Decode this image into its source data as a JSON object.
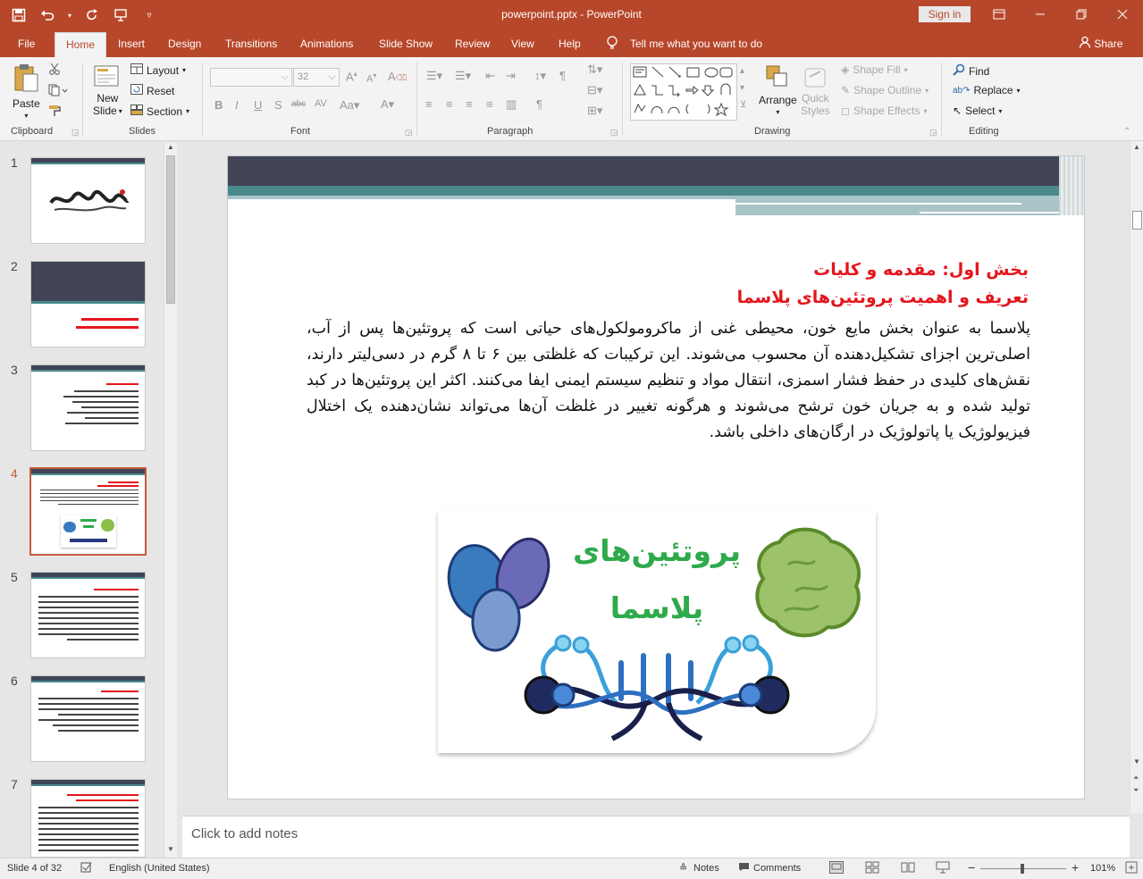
{
  "titlebar": {
    "title": "powerpoint.pptx  -  PowerPoint",
    "signin": "Sign in"
  },
  "tabs": [
    "File",
    "Home",
    "Insert",
    "Design",
    "Transitions",
    "Animations",
    "Slide Show",
    "Review",
    "View",
    "Help"
  ],
  "tellme": "Tell me what you want to do",
  "share": "Share",
  "ribbon": {
    "clipboard": {
      "paste": "Paste",
      "label": "Clipboard"
    },
    "slides": {
      "new_slide_1": "New",
      "new_slide_2": "Slide",
      "layout": "Layout",
      "reset": "Reset",
      "section": "Section",
      "label": "Slides"
    },
    "font": {
      "size": "32",
      "label": "Font"
    },
    "paragraph": {
      "label": "Paragraph"
    },
    "drawing": {
      "arrange": "Arrange",
      "quick_styles_1": "Quick",
      "quick_styles_2": "Styles",
      "shape_fill": "Shape Fill",
      "shape_outline": "Shape Outline",
      "shape_effects": "Shape Effects",
      "label": "Drawing"
    },
    "editing": {
      "find": "Find",
      "replace": "Replace",
      "select": "Select",
      "label": "Editing"
    }
  },
  "thumbnails": [
    {
      "num": "1"
    },
    {
      "num": "2"
    },
    {
      "num": "3"
    },
    {
      "num": "4"
    },
    {
      "num": "5"
    },
    {
      "num": "6"
    },
    {
      "num": "7"
    }
  ],
  "slide": {
    "heading1": "بخش اول: مقدمه و کلیات",
    "heading2": "تعریف و اهمیت پروتئین‌های پلاسما",
    "body": "پلاسما به عنوان بخش مایع خون، محیطی غنی از ماکرومولکول‌های حیاتی است که پروتئین‌ها پس از آب، اصلی‌ترین اجزای تشکیل‌دهنده آن محسوب می‌شوند. این ترکیبات که غلظتی بین ۶ تا ۸ گرم در دسی‌لیتر دارند، نقش‌های کلیدی در حفظ فشار اسمزی، انتقال مواد و تنظیم سیستم ایمنی ایفا می‌کنند. اکثر این پروتئین‌ها در کبد تولید شده و به جریان خون ترشح می‌شوند و هرگونه تغییر در غلظت آن‌ها می‌تواند نشان‌دهنده یک اختلال فیزیولوژیک یا پاتولوژیک در ارگان‌های داخلی باشد.",
    "figure_title_1": "پروتئین‌های",
    "figure_title_2": "پلاسما"
  },
  "notes_placeholder": "Click to add notes",
  "status": {
    "slide_of": "Slide 4 of 32",
    "language": "English (United States)",
    "notes": "Notes",
    "comments": "Comments",
    "zoom": "101%"
  },
  "colors": {
    "accent": "#b7472a",
    "slide_dark_band": "#404456",
    "slide_teal_band": "#4a8a8c",
    "heading_red": "#e3161c",
    "figure_green": "#2eaa4a"
  }
}
